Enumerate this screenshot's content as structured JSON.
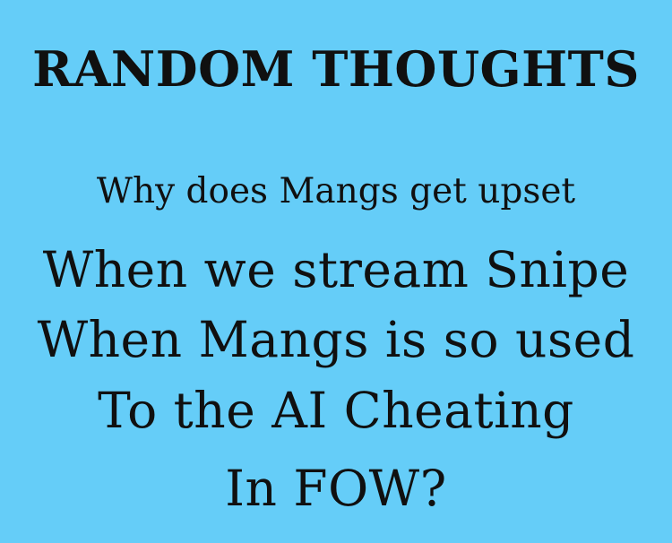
{
  "title": "RANDOM THOUGHTS",
  "subtitle": "Why does Mangs get upset",
  "lines": [
    "When we stream Snipe",
    "When Mangs is so used",
    "To the AI Cheating",
    "In FOW?"
  ],
  "colors": {
    "background": "#65cdf8",
    "text": "#101010"
  }
}
